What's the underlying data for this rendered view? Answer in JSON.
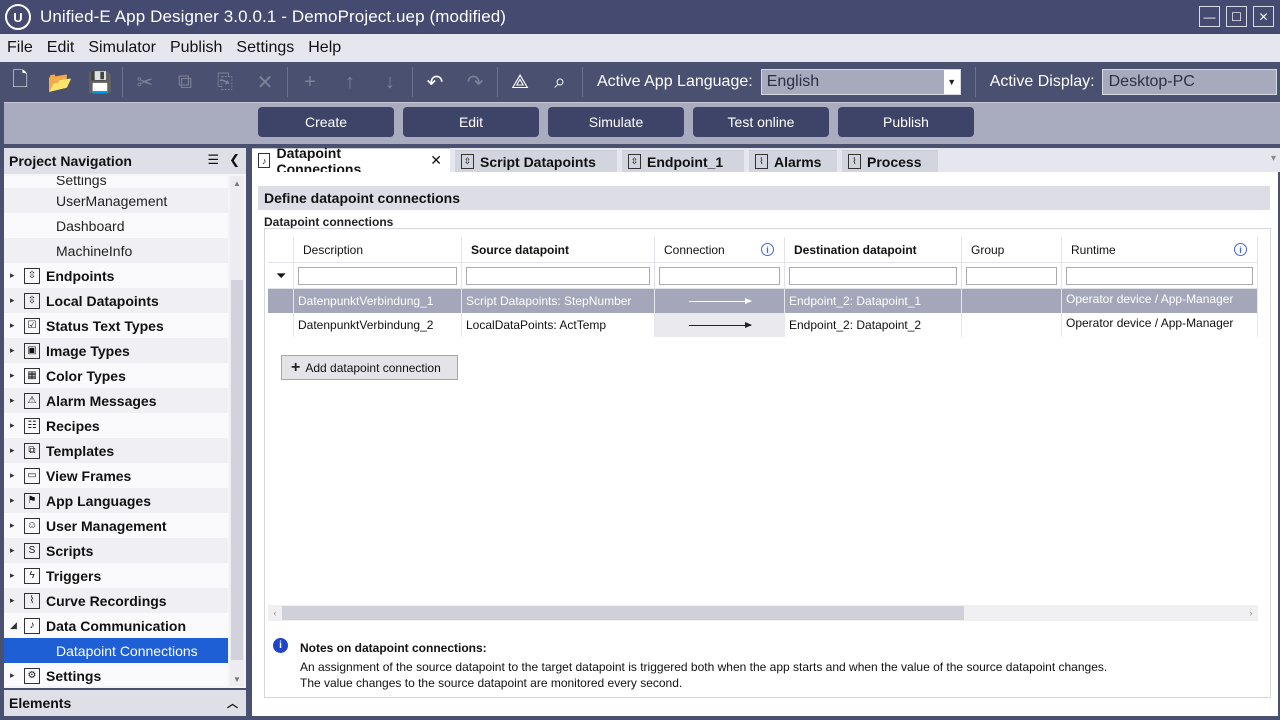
{
  "window": {
    "logo": "U",
    "title": "Unified-E App Designer 3.0.0.1 - DemoProject.uep  (modified)",
    "controls": {
      "minimize": "—",
      "maximize": "☐",
      "close": "✕"
    }
  },
  "menu": [
    "File",
    "Edit",
    "Simulator",
    "Publish",
    "Settings",
    "Help"
  ],
  "toolbar": {
    "icons": [
      {
        "name": "new-file-icon",
        "glyph": "🗋",
        "enabled": true
      },
      {
        "name": "open-folder-icon",
        "glyph": "📂",
        "enabled": true
      },
      {
        "name": "save-icon",
        "glyph": "💾",
        "enabled": true
      },
      {
        "name": "cut-icon",
        "glyph": "✂",
        "enabled": false
      },
      {
        "name": "copy-icon",
        "glyph": "⧉",
        "enabled": false
      },
      {
        "name": "paste-icon",
        "glyph": "⎘",
        "enabled": false
      },
      {
        "name": "delete-icon",
        "glyph": "✕",
        "enabled": false
      },
      {
        "name": "add-icon",
        "glyph": "+",
        "enabled": false
      },
      {
        "name": "move-up-icon",
        "glyph": "↑",
        "enabled": false
      },
      {
        "name": "move-down-icon",
        "glyph": "↓",
        "enabled": false
      },
      {
        "name": "undo-icon",
        "glyph": "↶",
        "enabled": true
      },
      {
        "name": "redo-icon",
        "glyph": "↷",
        "enabled": false
      },
      {
        "name": "network-icon",
        "glyph": "⟁",
        "enabled": true
      },
      {
        "name": "search-icon",
        "glyph": "⌕",
        "enabled": true
      }
    ],
    "language_label": "Active App Language:",
    "language_value": "English",
    "dropdown_glyph": "▼",
    "display_label": "Active Display:",
    "display_value": "Desktop-PC"
  },
  "modes": [
    "Create",
    "Edit",
    "Simulate",
    "Test online",
    "Publish"
  ],
  "navigation": {
    "title": "Project Navigation",
    "header_icons": {
      "menu": "☰",
      "collapse": "❮"
    },
    "items": [
      {
        "label": "Settings",
        "level": "child",
        "partial": true
      },
      {
        "label": "UserManagement",
        "level": "child"
      },
      {
        "label": "Dashboard",
        "level": "child"
      },
      {
        "label": "MachineInfo",
        "level": "child"
      },
      {
        "label": "Endpoints",
        "level": "parent",
        "icon": "⇳"
      },
      {
        "label": "Local Datapoints",
        "level": "parent",
        "icon": "⇳"
      },
      {
        "label": "Status Text Types",
        "level": "parent",
        "icon": "☑"
      },
      {
        "label": "Image Types",
        "level": "parent",
        "icon": "▣"
      },
      {
        "label": "Color Types",
        "level": "parent",
        "icon": "▦"
      },
      {
        "label": "Alarm Messages",
        "level": "parent",
        "icon": "⚠"
      },
      {
        "label": "Recipes",
        "level": "parent",
        "icon": "☷"
      },
      {
        "label": "Templates",
        "level": "parent",
        "icon": "⧉"
      },
      {
        "label": "View Frames",
        "level": "parent",
        "icon": "▭"
      },
      {
        "label": "App Languages",
        "level": "parent",
        "icon": "⚑"
      },
      {
        "label": "User Management",
        "level": "parent",
        "icon": "☺"
      },
      {
        "label": "Scripts",
        "level": "parent",
        "icon": "S"
      },
      {
        "label": "Triggers",
        "level": "parent",
        "icon": "ϟ"
      },
      {
        "label": "Curve Recordings",
        "level": "parent",
        "icon": "⌇"
      },
      {
        "label": "Data Communication",
        "level": "parent",
        "icon": "♪",
        "expanded": true
      },
      {
        "label": "Datapoint Connections",
        "level": "child",
        "selected": true
      },
      {
        "label": "Settings",
        "level": "parent",
        "icon": "⚙"
      }
    ],
    "scroll_up": "▲",
    "scroll_down": "▼"
  },
  "elements_panel": {
    "title": "Elements",
    "chevron": "︿"
  },
  "tabs": [
    {
      "label": "Datapoint Connections",
      "icon": "♪",
      "active": true,
      "closable": true,
      "width": 198
    },
    {
      "label": "Script Datapoints",
      "icon": "⇳",
      "width": 162
    },
    {
      "label": "Endpoint_1",
      "icon": "⇳",
      "width": 122
    },
    {
      "label": "Alarms",
      "icon": "⌇",
      "width": 88
    },
    {
      "label": "Process",
      "icon": "⌇",
      "width": 96
    }
  ],
  "tab_close": "✕",
  "tab_overflow": "▾",
  "editor": {
    "section_title": "Define datapoint connections",
    "group_title": "Datapoint connections",
    "filter_icon": "⏷",
    "info_glyph": "i",
    "columns": [
      {
        "label": "",
        "width": 26
      },
      {
        "label": "Description",
        "width": 168
      },
      {
        "label": "Source datapoint",
        "width": 193,
        "bold": true
      },
      {
        "label": "Connection",
        "width": 130,
        "info": true
      },
      {
        "label": "Destination datapoint",
        "width": 177,
        "bold": true
      },
      {
        "label": "Group",
        "width": 100
      },
      {
        "label": "Runtime",
        "width": 196,
        "info": true
      }
    ],
    "rows": [
      {
        "description": "DatenpunktVerbindung_1",
        "source": "Script Datapoints: StepNumber",
        "destination": "Endpoint_2: Datapoint_1",
        "group": "",
        "runtime": "Operator device / App-Manager",
        "selected": true
      },
      {
        "description": "DatenpunktVerbindung_2",
        "source": "LocalDataPoints: ActTemp",
        "destination": "Endpoint_2: Datapoint_2",
        "group": "",
        "runtime": "Operator device / App-Manager"
      }
    ],
    "add_button_icon": "+",
    "add_button": "Add datapoint connection",
    "hscroll": {
      "left": "‹",
      "right": "›"
    },
    "notes_icon": "i",
    "notes_title": "Notes on datapoint connections:",
    "notes_line1": "An assignment of the source datapoint to the target datapoint is triggered both when the app starts and when the value of the source datapoint changes.",
    "notes_line2": "The value changes to the source datapoint are monitored every second."
  }
}
